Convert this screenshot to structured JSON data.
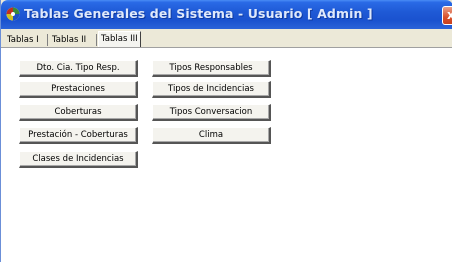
{
  "window": {
    "title": "Tablas Generales del Sistema - Usuario [ Admin ]",
    "close_glyph": "x"
  },
  "tabs": [
    {
      "label": "Tablas I",
      "active": false
    },
    {
      "label": "Tablas II",
      "active": false
    },
    {
      "label": "Tablas III",
      "active": true
    }
  ],
  "buttons": {
    "col1": [
      "Dto. Cia. Tipo Resp.",
      "Prestaciones",
      "Coberturas",
      "Prestación - Coberturas",
      "Clases de Incidencias"
    ],
    "col2": [
      "Tipos Responsables",
      "Tipos de Incidencias",
      "Tipos Conversacion",
      "Clima"
    ]
  },
  "colors": {
    "titlebar": "#1f5ad6",
    "window_bg": "#ece9d8",
    "panel_bg": "#ffffff"
  }
}
